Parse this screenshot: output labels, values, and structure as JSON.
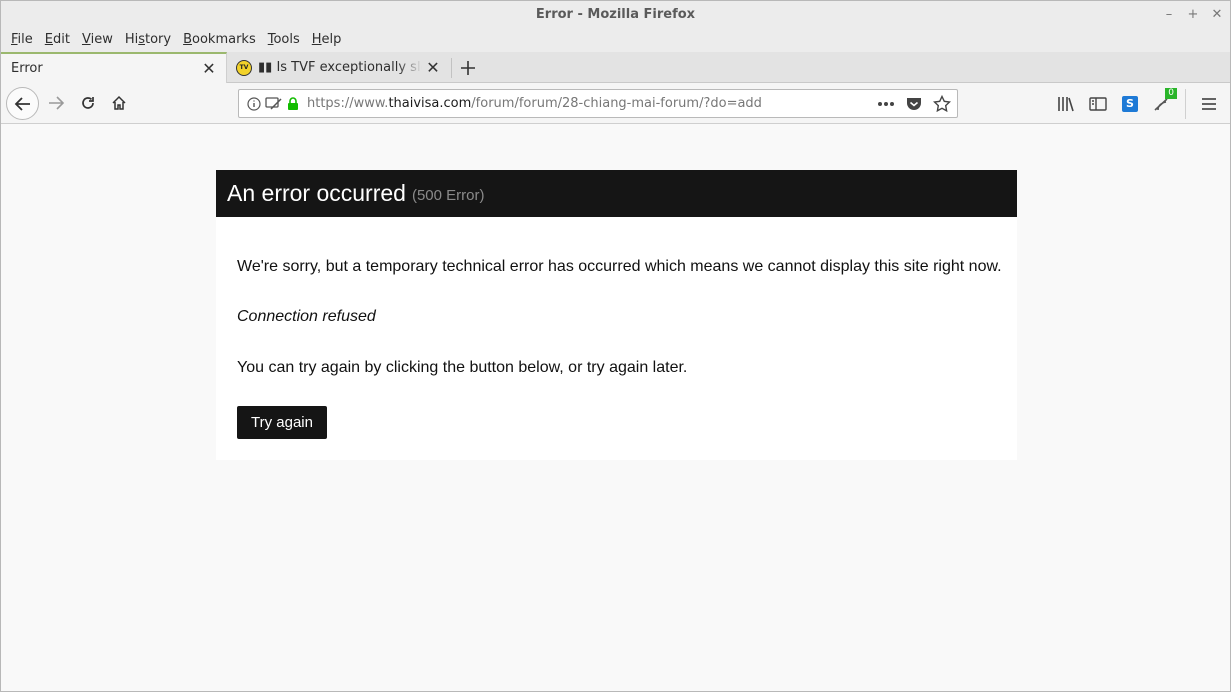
{
  "window": {
    "title": "Error - Mozilla Firefox",
    "controls": {
      "minimize": "–",
      "maximize": "+",
      "close": "✕"
    }
  },
  "menubar": {
    "items": [
      {
        "pre": "",
        "u": "F",
        "post": "ile"
      },
      {
        "pre": "",
        "u": "E",
        "post": "dit"
      },
      {
        "pre": "",
        "u": "V",
        "post": "iew"
      },
      {
        "pre": "Hi",
        "u": "s",
        "post": "tory"
      },
      {
        "pre": "",
        "u": "B",
        "post": "ookmarks"
      },
      {
        "pre": "",
        "u": "T",
        "post": "ools"
      },
      {
        "pre": "",
        "u": "H",
        "post": "elp"
      }
    ]
  },
  "tabs": [
    {
      "label": "Error",
      "active": true
    },
    {
      "label": "▮▮ Is TVF exceptionally slow today?",
      "active": false,
      "favicon_text": "TV"
    }
  ],
  "navbar": {
    "url_scheme": "https://www.",
    "url_host": "thaivisa.com",
    "url_path": "/forum/forum/28-chiang-mai-forum/?do=add",
    "extension_badge": "0",
    "skype_letter": "S"
  },
  "error": {
    "title": "An error occurred",
    "code": "(500 Error)",
    "message": "We're sorry, but a temporary technical error has occurred which means we cannot display this site right now.",
    "detail": "Connection refused",
    "hint": "You can try again by clicking the button below, or try again later.",
    "button_label": "Try again"
  },
  "colors": {
    "error_header": "#151515",
    "tab_accent": "#9bb86e",
    "lock_green": "#12bc00"
  }
}
